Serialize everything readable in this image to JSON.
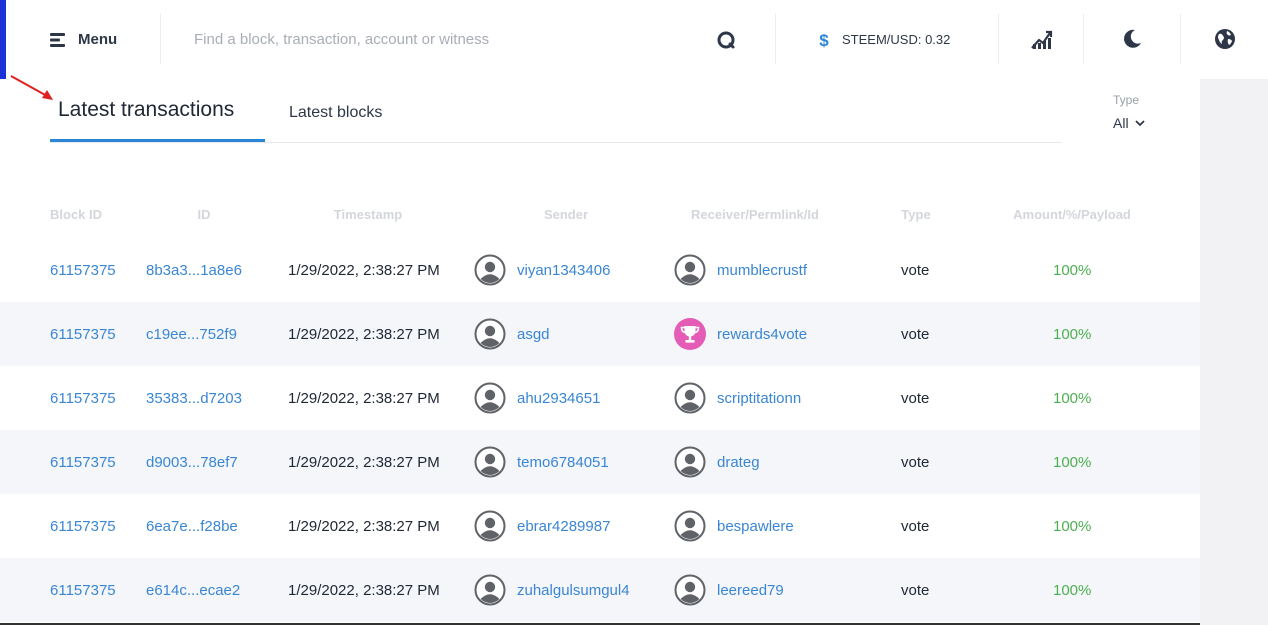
{
  "header": {
    "menu_label": "Menu",
    "search_placeholder": "Find a block, transaction, account or witness",
    "price_label": "STEEM/USD: 0.32",
    "accent_color": "#1b33d6",
    "icons": [
      "menu-icon",
      "search-icon",
      "dollar-icon",
      "chart-icon",
      "moon-icon",
      "globe-icon"
    ]
  },
  "tabs": [
    {
      "label": "Latest transactions",
      "active": true
    },
    {
      "label": "Latest blocks",
      "active": false
    }
  ],
  "filter": {
    "label": "Type",
    "value": "All"
  },
  "table": {
    "columns": [
      "Block ID",
      "ID",
      "Timestamp",
      "Sender",
      "Receiver/Permlink/Id",
      "Type",
      "Amount/%/Payload"
    ],
    "rows": [
      {
        "block_id": "61157375",
        "tx_id": "8b3a3...1a8e6",
        "timestamp": "1/29/2022, 2:38:27 PM",
        "sender": "viyan1343406",
        "receiver": "mumblecrustf",
        "receiver_avatar": "default",
        "type": "vote",
        "amount": "100%"
      },
      {
        "block_id": "61157375",
        "tx_id": "c19ee...752f9",
        "timestamp": "1/29/2022, 2:38:27 PM",
        "sender": "asgd",
        "receiver": "rewards4vote",
        "receiver_avatar": "trophy",
        "type": "vote",
        "amount": "100%"
      },
      {
        "block_id": "61157375",
        "tx_id": "35383...d7203",
        "timestamp": "1/29/2022, 2:38:27 PM",
        "sender": "ahu2934651",
        "receiver": "scriptitationn",
        "receiver_avatar": "default",
        "type": "vote",
        "amount": "100%"
      },
      {
        "block_id": "61157375",
        "tx_id": "d9003...78ef7",
        "timestamp": "1/29/2022, 2:38:27 PM",
        "sender": "temo6784051",
        "receiver": "drateg",
        "receiver_avatar": "default",
        "type": "vote",
        "amount": "100%"
      },
      {
        "block_id": "61157375",
        "tx_id": "6ea7e...f28be",
        "timestamp": "1/29/2022, 2:38:27 PM",
        "sender": "ebrar4289987",
        "receiver": "bespawlere",
        "receiver_avatar": "default",
        "type": "vote",
        "amount": "100%"
      },
      {
        "block_id": "61157375",
        "tx_id": "e614c...ecae2",
        "timestamp": "1/29/2022, 2:38:27 PM",
        "sender": "zuhalgulsumgul4",
        "receiver": "leereed79",
        "receiver_avatar": "default",
        "type": "vote",
        "amount": "100%"
      }
    ]
  }
}
